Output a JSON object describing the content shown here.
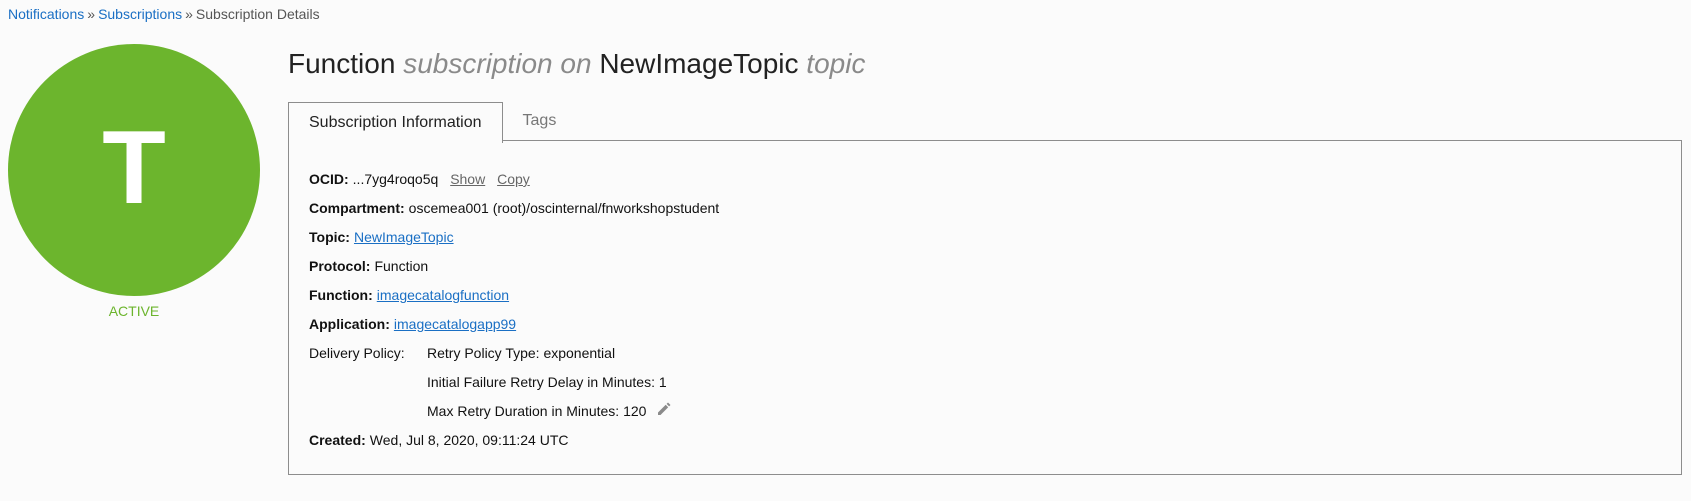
{
  "breadcrumb": {
    "items": [
      "Notifications",
      "Subscriptions",
      "Subscription Details"
    ],
    "separator": "»"
  },
  "avatar": {
    "letter": "T",
    "color": "#6cb52d"
  },
  "status": "ACTIVE",
  "title": {
    "protocol": "Function",
    "middle": "subscription on",
    "topic_name": "NewImageTopic",
    "suffix": "topic"
  },
  "tabs": [
    {
      "label": "Subscription Information",
      "active": true
    },
    {
      "label": "Tags",
      "active": false
    }
  ],
  "details": {
    "ocid": {
      "label": "OCID:",
      "value": "...7yg4roqo5q",
      "show": "Show",
      "copy": "Copy"
    },
    "compartment": {
      "label": "Compartment:",
      "value": "oscemea001 (root)/oscinternal/fnworkshopstudent"
    },
    "topic": {
      "label": "Topic:",
      "value": "NewImageTopic"
    },
    "protocol": {
      "label": "Protocol:",
      "value": "Function"
    },
    "function": {
      "label": "Function:",
      "value": "imagecatalogfunction"
    },
    "application": {
      "label": "Application:",
      "value": "imagecatalogapp99"
    },
    "delivery_policy": {
      "label": "Delivery Policy:",
      "retry_type": "Retry Policy Type: exponential",
      "initial_delay": "Initial Failure Retry Delay in Minutes: 1",
      "max_duration": "Max Retry Duration in Minutes: 120",
      "edit_icon": "pencil-icon"
    },
    "created": {
      "label": "Created:",
      "value": "Wed, Jul 8, 2020, 09:11:24 UTC"
    }
  },
  "colors": {
    "accent": "#6cb52d",
    "link": "#1a6fc4"
  }
}
